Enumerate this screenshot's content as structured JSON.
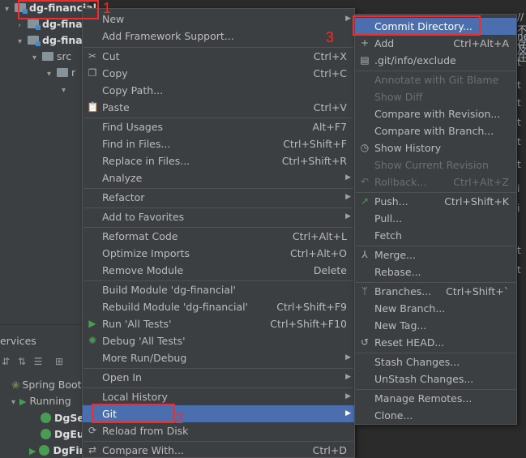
{
  "tree": {
    "root": "dg-financial",
    "row2": "dg-fina",
    "row3": "dg-fina",
    "row4": "src",
    "row5": "r"
  },
  "editor_code": [
    "// 不存在",
    "ne 及",
    "t",
    "t",
    "t",
    "t",
    "t",
    "t",
    "i",
    "i",
    "t",
    "t"
  ],
  "services": {
    "title": "ervices",
    "spring_boot": "Spring Boot",
    "running": "Running",
    "app1": "DgSer",
    "app2": "DgEu",
    "app3": "DgFin"
  },
  "context_menu": {
    "new": "New",
    "add_framework": "Add Framework Support...",
    "cut": "Cut",
    "cut_sc": "Ctrl+X",
    "copy": "Copy",
    "copy_sc": "Ctrl+C",
    "copy_path": "Copy Path...",
    "paste": "Paste",
    "paste_sc": "Ctrl+V",
    "find_usages": "Find Usages",
    "find_usages_sc": "Alt+F7",
    "find_in_files": "Find in Files...",
    "find_in_files_sc": "Ctrl+Shift+F",
    "replace_in_files": "Replace in Files...",
    "replace_in_files_sc": "Ctrl+Shift+R",
    "analyze": "Analyze",
    "refactor": "Refactor",
    "add_favorites": "Add to Favorites",
    "reformat": "Reformat Code",
    "reformat_sc": "Ctrl+Alt+L",
    "optimize": "Optimize Imports",
    "optimize_sc": "Ctrl+Alt+O",
    "remove_module": "Remove Module",
    "remove_module_sc": "Delete",
    "build_module": "Build Module 'dg-financial'",
    "rebuild_module": "Rebuild Module 'dg-financial'",
    "rebuild_module_sc": "Ctrl+Shift+F9",
    "run_tests": "Run 'All Tests'",
    "run_tests_sc": "Ctrl+Shift+F10",
    "debug_tests": "Debug 'All Tests'",
    "more_run": "More Run/Debug",
    "open_in": "Open In",
    "local_history": "Local History",
    "git": "Git",
    "reload": "Reload from Disk",
    "compare_with": "Compare With...",
    "compare_with_sc": "Ctrl+D"
  },
  "git_menu": {
    "commit_dir": "Commit Directory...",
    "add": "Add",
    "add_sc": "Ctrl+Alt+A",
    "exclude": ".git/info/exclude",
    "annotate": "Annotate with Git Blame",
    "show_diff": "Show Diff",
    "compare_revision": "Compare with Revision...",
    "compare_branch": "Compare with Branch...",
    "show_history": "Show History",
    "show_current_revision": "Show Current Revision",
    "rollback": "Rollback...",
    "rollback_sc": "Ctrl+Alt+Z",
    "push": "Push...",
    "push_sc": "Ctrl+Shift+K",
    "pull": "Pull...",
    "fetch": "Fetch",
    "merge": "Merge...",
    "rebase": "Rebase...",
    "branches": "Branches...",
    "branches_sc": "Ctrl+Shift+`",
    "new_branch": "New Branch...",
    "new_tag": "New Tag...",
    "reset_head": "Reset HEAD...",
    "stash": "Stash Changes...",
    "unstash": "UnStash Changes...",
    "manage_remotes": "Manage Remotes...",
    "clone": "Clone..."
  },
  "annotations": {
    "n1": "1",
    "n2": "2",
    "n3": "3"
  },
  "colors": {
    "selection": "#4b6eaf",
    "annotation": "#ff2626",
    "menu_bg": "#3c3f41"
  }
}
